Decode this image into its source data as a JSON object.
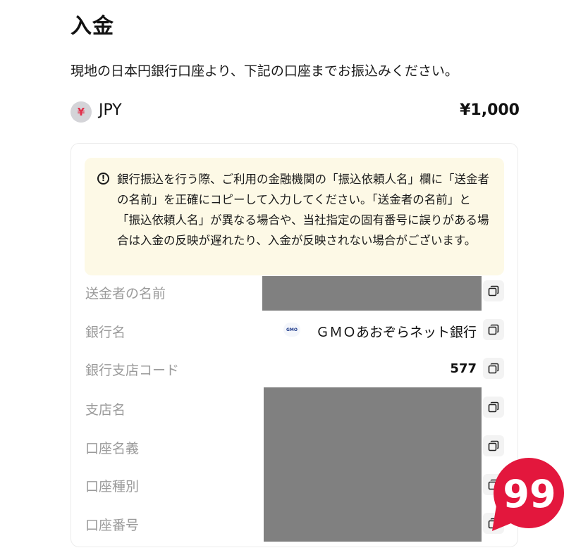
{
  "page": {
    "title": "入金",
    "description": "現地の日本円銀行口座より、下記の口座までお振込みください。"
  },
  "currency": {
    "icon_symbol": "¥",
    "code": "JPY",
    "amount": "¥1,000"
  },
  "notice": {
    "icon": "!",
    "text": "銀行振込を行う際、ご利用の金融機関の「振込依頼人名」欄に「送金者の名前」を正確にコピーして入力してください。「送金者の名前」と「振込依頼人名」が異なる場合や、当社指定の固有番号に誤りがある場合は入金の反映が遅れたり、入金が反映されない場合がございます。"
  },
  "details": {
    "sender_name": {
      "label": "送金者の名前"
    },
    "bank_name": {
      "label": "銀行名",
      "value": "ＧＭＯあおぞらネット銀行",
      "logo_text": "GMO"
    },
    "branch_code": {
      "label": "銀行支店コード",
      "value": "577"
    },
    "branch_name": {
      "label": "支店名"
    },
    "account_holder": {
      "label": "口座名義"
    },
    "account_type": {
      "label": "口座種別"
    },
    "account_number": {
      "label": "口座番号"
    }
  },
  "badge": {
    "text": "99"
  },
  "colors": {
    "mask": "#808080",
    "notice_bg": "#fdf9e6",
    "label": "#9a9a9a",
    "badge": "#e3173d"
  }
}
